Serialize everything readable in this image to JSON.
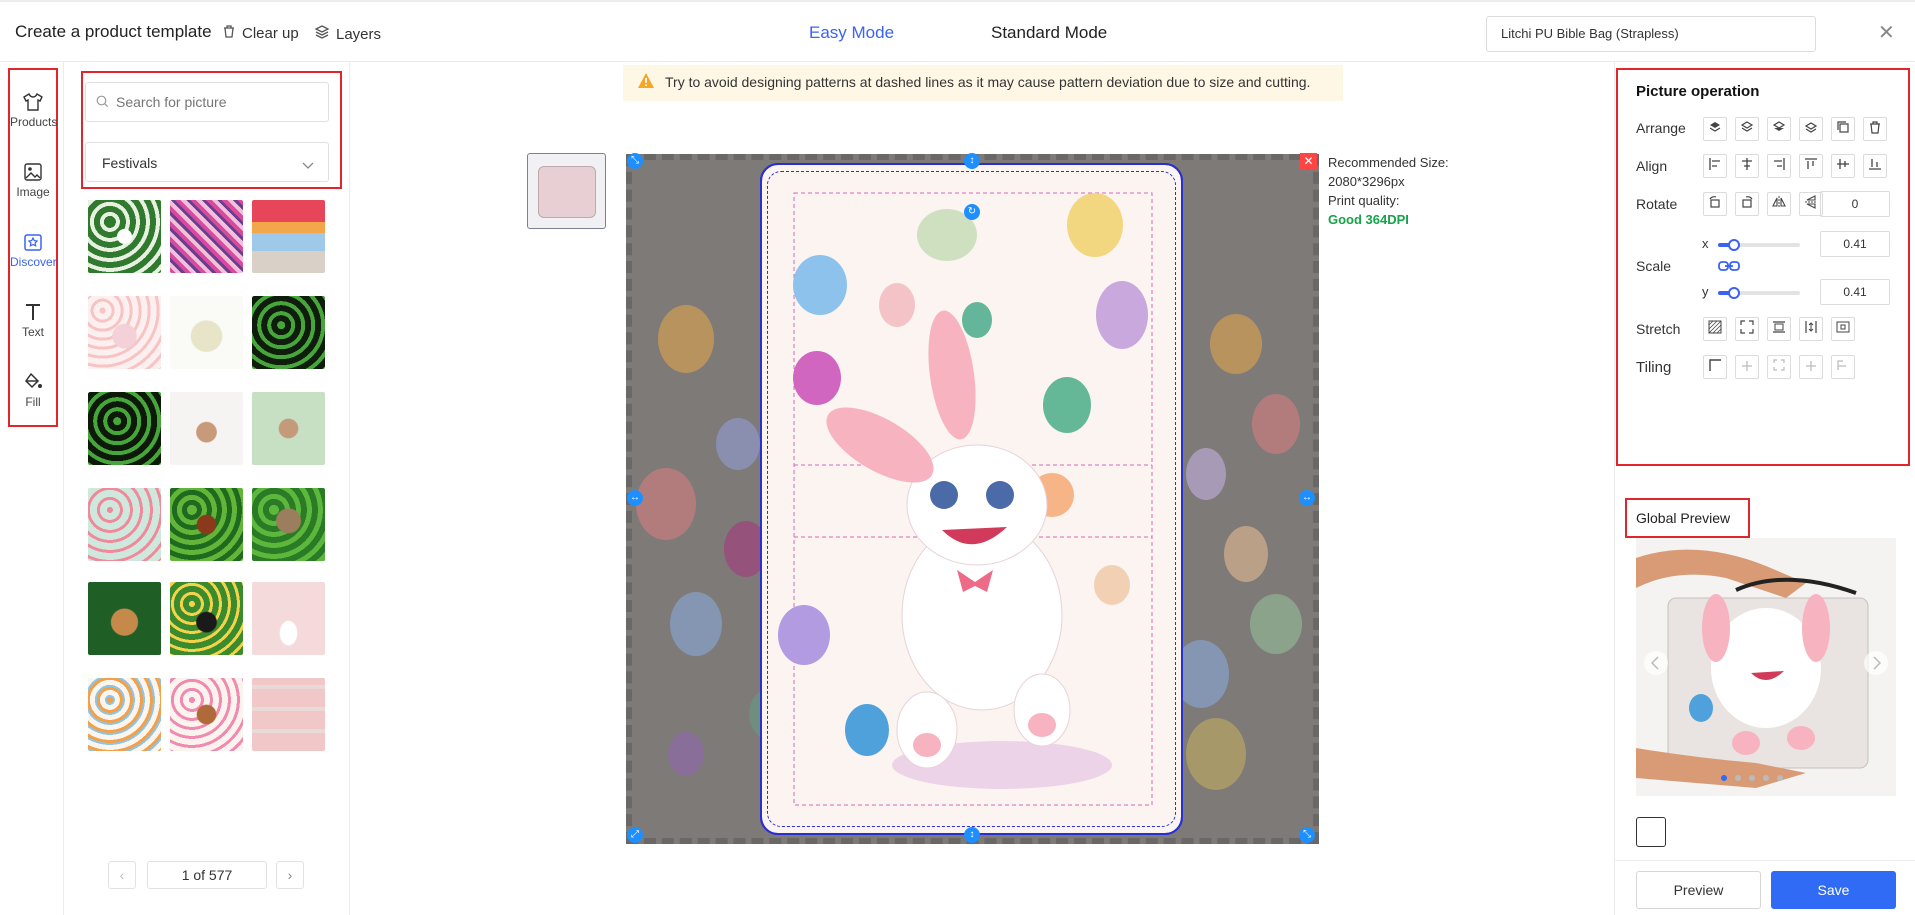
{
  "header": {
    "title": "Create a product template",
    "clear_up": "Clear up",
    "layers": "Layers",
    "easy_mode": "Easy Mode",
    "standard_mode": "Standard Mode",
    "product": "Litchi PU Bible Bag (Strapless)",
    "close": "✕"
  },
  "nav": {
    "items": [
      {
        "label": "Products",
        "icon": "shirt-icon"
      },
      {
        "label": "Image",
        "icon": "image-icon"
      },
      {
        "label": "Discover",
        "icon": "discover-icon",
        "active": true
      },
      {
        "label": "Text",
        "icon": "text-icon"
      },
      {
        "label": "Fill",
        "icon": "paint-bucket-icon"
      }
    ]
  },
  "search": {
    "placeholder": "Search for picture",
    "category": "Festivals"
  },
  "pager": {
    "page_text": "1 of 577",
    "prev": "‹",
    "next": "›"
  },
  "canvas": {
    "warning": "Try to avoid designing patterns at dashed lines as it may cause pattern deviation due to size and cutting.",
    "recommended_label": "Recommended Size:",
    "recommended_value": "2080*3296px",
    "quality_label": "Print quality:",
    "quality_value": "Good 364DPI"
  },
  "operation": {
    "title": "Picture operation",
    "arrange": "Arrange",
    "align": "Align",
    "rotate": "Rotate",
    "rotate_value": "0",
    "scale": "Scale",
    "scale_x_label": "x",
    "scale_x_value": "0.41",
    "scale_y_label": "y",
    "scale_y_value": "0.41",
    "stretch": "Stretch",
    "tiling": "Tiling"
  },
  "global_preview": {
    "title": "Global Preview"
  },
  "buttons": {
    "preview": "Preview",
    "save": "Save"
  },
  "colors": {
    "accent": "#3a63f3",
    "highlight": "#e2252b",
    "save": "#2f6bf4",
    "good": "#16a34a"
  }
}
